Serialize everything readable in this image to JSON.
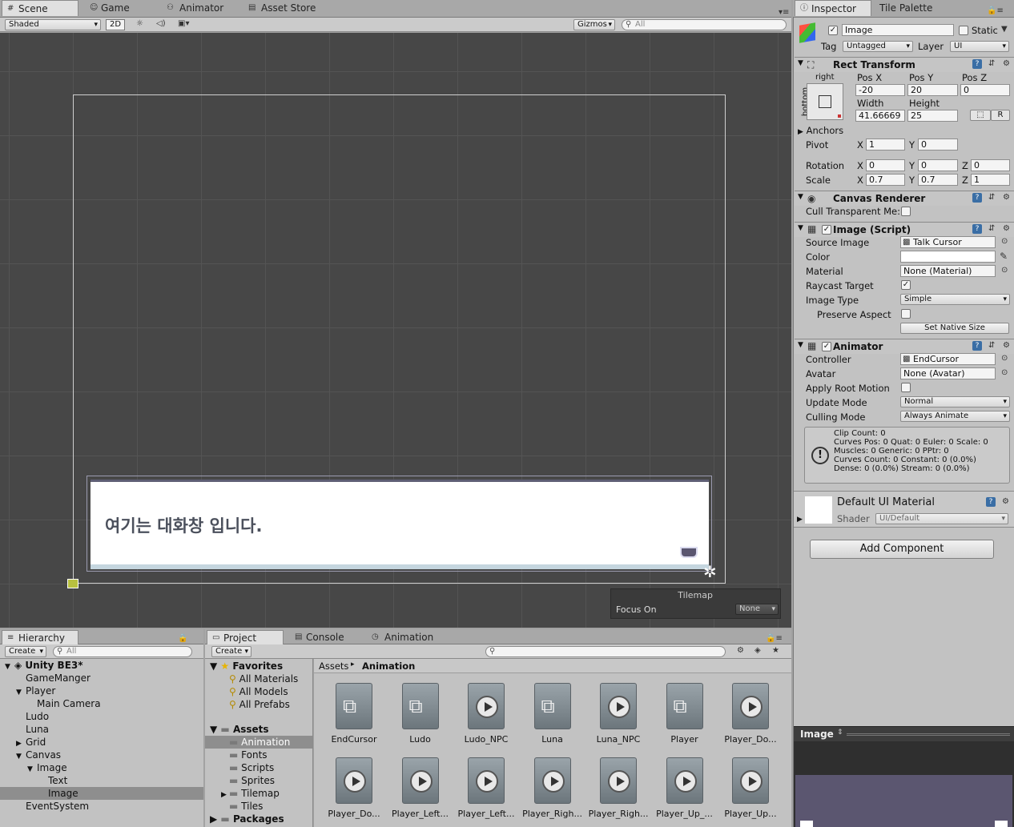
{
  "scene": {
    "tabs": [
      "Scene",
      "Game",
      "Animator",
      "Asset Store"
    ],
    "shading": "Shaded",
    "mode2d": "2D",
    "gizmos": "Gizmos",
    "search_placeholder": "All",
    "dialog_text": "여기는 대화창 입니다.",
    "tilemap": {
      "title": "Tilemap",
      "focus_label": "Focus On",
      "focus_value": "None"
    }
  },
  "inspector": {
    "tabs": [
      "Inspector",
      "Tile Palette"
    ],
    "object_name": "Image",
    "static_label": "Static",
    "tag_label": "Tag",
    "tag_value": "Untagged",
    "layer_label": "Layer",
    "layer_value": "UI",
    "rect": {
      "title": "Rect Transform",
      "anchor_h": "right",
      "anchor_v": "bottom",
      "pos_x_label": "Pos X",
      "pos_y_label": "Pos Y",
      "pos_z_label": "Pos Z",
      "pos_x": "-20",
      "pos_y": "20",
      "pos_z": "0",
      "width_label": "Width",
      "height_label": "Height",
      "width": "41.66669",
      "height": "25",
      "r_button": "R",
      "anchors_label": "Anchors",
      "pivot_label": "Pivot",
      "pivot_x": "1",
      "pivot_y": "0",
      "rotation_label": "Rotation",
      "rot_x": "0",
      "rot_y": "0",
      "rot_z": "0",
      "scale_label": "Scale",
      "scale_x": "0.7",
      "scale_y": "0.7",
      "scale_z": "1",
      "x": "X",
      "y": "Y",
      "z": "Z"
    },
    "canvas_renderer": {
      "title": "Canvas Renderer",
      "cull_label": "Cull Transparent Me:"
    },
    "image_script": {
      "title": "Image (Script)",
      "source_label": "Source Image",
      "source_value": "Talk Cursor",
      "color_label": "Color",
      "material_label": "Material",
      "material_value": "None (Material)",
      "raycast_label": "Raycast Target",
      "type_label": "Image Type",
      "type_value": "Simple",
      "preserve_label": "Preserve Aspect",
      "native_button": "Set Native Size"
    },
    "animator": {
      "title": "Animator",
      "controller_label": "Controller",
      "controller_value": "EndCursor",
      "avatar_label": "Avatar",
      "avatar_value": "None (Avatar)",
      "root_label": "Apply Root Motion",
      "update_label": "Update Mode",
      "update_value": "Normal",
      "culling_label": "Culling Mode",
      "culling_value": "Always Animate",
      "info": [
        "Clip Count: 0",
        "Curves Pos: 0 Quat: 0 Euler: 0 Scale: 0",
        "Muscles: 0 Generic: 0 PPtr: 0",
        "Curves Count: 0 Constant: 0 (0.0%)",
        "Dense: 0 (0.0%) Stream: 0 (0.0%)"
      ]
    },
    "material": {
      "title": "Default UI Material",
      "shader_label": "Shader",
      "shader_value": "UI/Default"
    },
    "add_component": "Add Component",
    "preview_title": "Image"
  },
  "hierarchy": {
    "tab": "Hierarchy",
    "create": "Create",
    "search_placeholder": "All",
    "items": [
      {
        "label": "Unity BE3*",
        "indent": 0,
        "bold": true,
        "arrow": "▼"
      },
      {
        "label": "GameManger",
        "indent": 1,
        "arrow": ""
      },
      {
        "label": "Player",
        "indent": 1,
        "arrow": "▼"
      },
      {
        "label": "Main Camera",
        "indent": 2,
        "arrow": ""
      },
      {
        "label": "Ludo",
        "indent": 1,
        "arrow": ""
      },
      {
        "label": "Luna",
        "indent": 1,
        "arrow": ""
      },
      {
        "label": "Grid",
        "indent": 1,
        "arrow": "▶"
      },
      {
        "label": "Canvas",
        "indent": 1,
        "arrow": "▼"
      },
      {
        "label": "Image",
        "indent": 2,
        "arrow": "▼"
      },
      {
        "label": "Text",
        "indent": 3,
        "arrow": ""
      },
      {
        "label": "Image",
        "indent": 3,
        "arrow": "",
        "selected": true
      },
      {
        "label": "EventSystem",
        "indent": 1,
        "arrow": ""
      }
    ]
  },
  "project": {
    "tabs": [
      "Project",
      "Console",
      "Animation"
    ],
    "create": "Create",
    "favorites_label": "Favorites",
    "favorites": [
      "All Materials",
      "All Models",
      "All Prefabs"
    ],
    "assets_label": "Assets",
    "folders": [
      {
        "label": "Animation",
        "selected": true,
        "arrow": ""
      },
      {
        "label": "Fonts",
        "arrow": ""
      },
      {
        "label": "Scripts",
        "arrow": ""
      },
      {
        "label": "Sprites",
        "arrow": ""
      },
      {
        "label": "Tilemap",
        "arrow": "▶"
      },
      {
        "label": "Tiles",
        "arrow": ""
      }
    ],
    "packages_label": "Packages",
    "breadcrumb_root": "Assets",
    "breadcrumb_current": "Animation",
    "assets": [
      {
        "label": "EndCursor",
        "kind": "controller"
      },
      {
        "label": "Ludo",
        "kind": "controller"
      },
      {
        "label": "Ludo_NPC",
        "kind": "clip"
      },
      {
        "label": "Luna",
        "kind": "controller"
      },
      {
        "label": "Luna_NPC",
        "kind": "clip"
      },
      {
        "label": "Player",
        "kind": "controller"
      },
      {
        "label": "Player_Do...",
        "kind": "clip"
      },
      {
        "label": "Player_Do...",
        "kind": "clip"
      },
      {
        "label": "Player_Left...",
        "kind": "clip"
      },
      {
        "label": "Player_Left...",
        "kind": "clip"
      },
      {
        "label": "Player_Righ...",
        "kind": "clip"
      },
      {
        "label": "Player_Righ...",
        "kind": "clip"
      },
      {
        "label": "Player_Up_...",
        "kind": "clip"
      },
      {
        "label": "Player_Up...",
        "kind": "clip"
      }
    ]
  }
}
